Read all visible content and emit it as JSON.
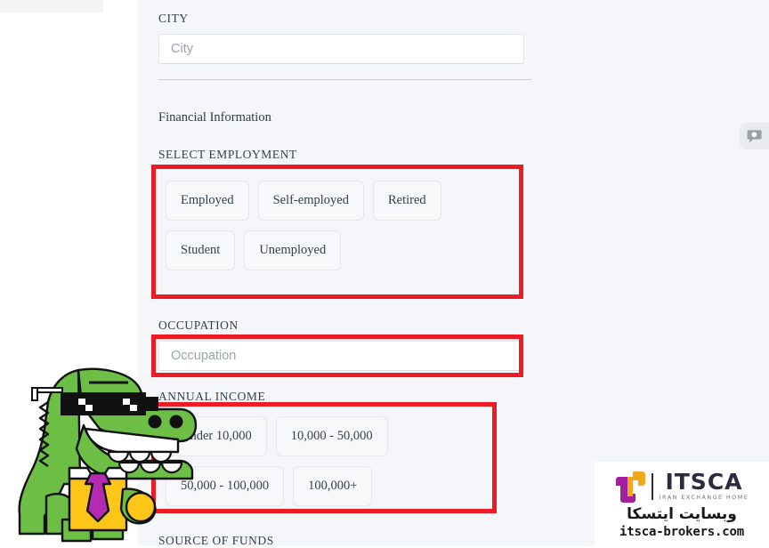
{
  "form": {
    "city": {
      "label": "CITY",
      "placeholder": "City",
      "value": ""
    },
    "section_title": "Financial Information",
    "employment": {
      "label": "SELECT EMPLOYMENT",
      "options": [
        "Employed",
        "Self-employed",
        "Retired",
        "Student",
        "Unemployed"
      ]
    },
    "occupation": {
      "label": "OCCUPATION",
      "placeholder": "Occupation",
      "value": ""
    },
    "annual_income": {
      "label": "ANNUAL INCOME",
      "options": [
        "Under 10,000",
        "10,000 - 50,000",
        "50,000 - 100,000",
        "100,000+"
      ]
    },
    "source_of_funds": {
      "label": "SOURCE OF FUNDS"
    }
  },
  "annotations": {
    "color": "#ed1c24",
    "regions": [
      "select-employment",
      "occupation",
      "annual-income"
    ]
  },
  "side_widget": {
    "icon": "chat-bubble-icon"
  },
  "mascot": {
    "name": "crocodile-mascot",
    "colors": {
      "body": "#6cbe45",
      "shirt": "#ffc61a",
      "tie": "#b32bb0",
      "glasses": "#1a1a1a",
      "coin": "#ffc61a"
    }
  },
  "watermark": {
    "brand": "ITSCA",
    "tagline": "IRAN EXCHANGE HOME",
    "persian_text": "وبسایت ایتسکا",
    "url": "itsca-brokers.com",
    "colors": {
      "mark_purple": "#a21fa0",
      "mark_gold": "#f2a81d",
      "text_dark": "#2b2b3d"
    }
  },
  "theme": {
    "page_background": "#f4f6fa",
    "chip_background": "#f7f8fa",
    "input_background": "#ffffff",
    "text": "#33404e"
  }
}
